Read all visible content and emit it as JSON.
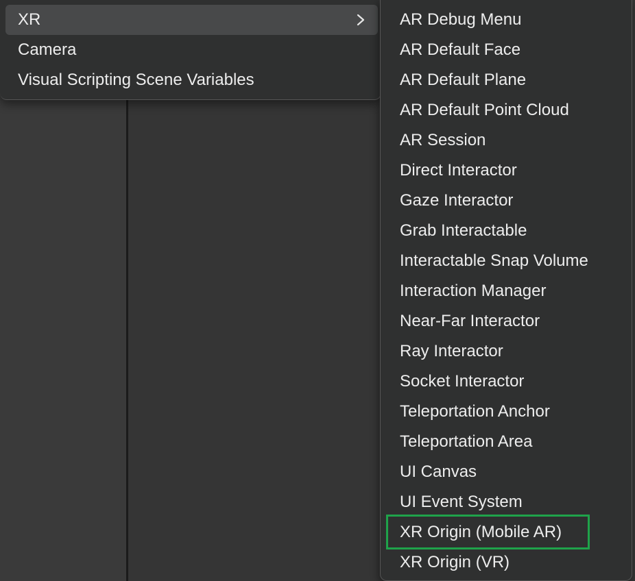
{
  "parent_menu": {
    "items": [
      {
        "label": "XR",
        "has_submenu": true,
        "active": true
      },
      {
        "label": "Camera",
        "has_submenu": false,
        "active": false
      },
      {
        "label": "Visual Scripting Scene Variables",
        "has_submenu": false,
        "active": false
      }
    ],
    "chevron_icon": "chevron-right-icon"
  },
  "submenu": {
    "items": [
      "AR Debug Menu",
      "AR Default Face",
      "AR Default Plane",
      "AR Default Point Cloud",
      "AR Session",
      "Direct Interactor",
      "Gaze Interactor",
      "Grab Interactable",
      "Interactable Snap Volume",
      "Interaction Manager",
      "Near-Far Interactor",
      "Ray Interactor",
      "Socket Interactor",
      "Teleportation Anchor",
      "Teleportation Area",
      "UI Canvas",
      "UI Event System",
      "XR Origin (Mobile AR)",
      "XR Origin (VR)"
    ],
    "highlighted_item": "XR Origin (Mobile AR)"
  },
  "colors": {
    "menu_bg": "#2f3030",
    "active_row": "#48494a",
    "text": "#ededed",
    "highlight_border": "#1fa34a",
    "editor_bg": "#383838"
  }
}
